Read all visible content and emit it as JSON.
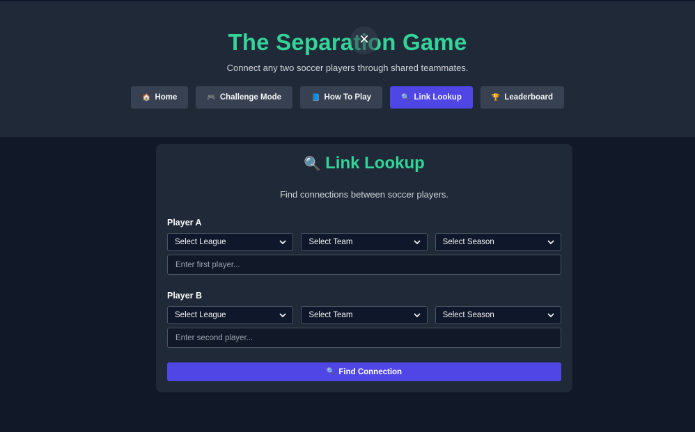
{
  "header": {
    "title": "The Separation Game",
    "subtitle": "Connect any two soccer players through shared teammates.",
    "close_icon": "×"
  },
  "nav": [
    {
      "icon": "🏠",
      "label": "Home",
      "active": false
    },
    {
      "icon": "🎮",
      "label": "Challenge Mode",
      "active": false
    },
    {
      "icon": "📘",
      "label": "How To Play",
      "active": false
    },
    {
      "icon": "🔍",
      "label": "Link Lookup",
      "active": true
    },
    {
      "icon": "🏆",
      "label": "Leaderboard",
      "active": false
    }
  ],
  "card": {
    "icon": "🔍",
    "title": "Link Lookup",
    "description": "Find connections between soccer players.",
    "player_a": {
      "label": "Player A",
      "league": "Select League",
      "team": "Select Team",
      "season": "Select Season",
      "placeholder": "Enter first player..."
    },
    "player_b": {
      "label": "Player B",
      "league": "Select League",
      "team": "Select Team",
      "season": "Select Season",
      "placeholder": "Enter second player..."
    },
    "find_button": {
      "icon": "🔍",
      "label": "Find Connection"
    }
  },
  "colors": {
    "accent_green": "#34d399",
    "accent_purple": "#4f46e5",
    "background": "#111827",
    "panel": "#1f2937"
  }
}
